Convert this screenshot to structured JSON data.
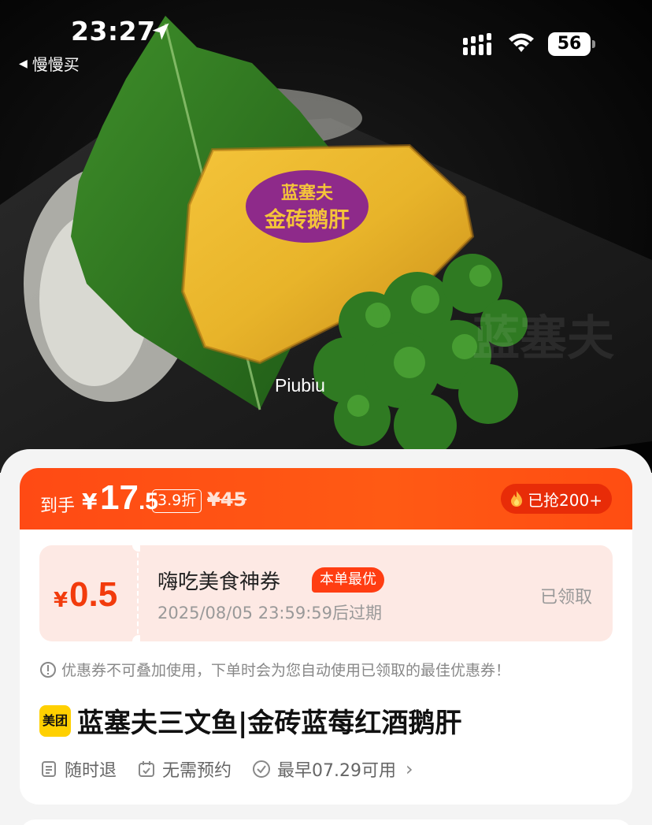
{
  "status_bar": {
    "time": "23:27",
    "back_app": "慢慢买",
    "battery": "56"
  },
  "hero": {
    "watermark": "Piubiu",
    "package_label_line1": "蓝塞夫",
    "package_label_line2": "金砖鹅肝",
    "bg_text": "蓝塞夫"
  },
  "price_bar": {
    "label": "到手",
    "currency": "¥",
    "price_int": "17",
    "price_dec": ".5",
    "discount": "3.9折",
    "original": "¥45",
    "sold": "已抢200+"
  },
  "coupon": {
    "currency": "¥",
    "value": "0.5",
    "title": "嗨吃美食神券",
    "tag": "本单最优",
    "expire": "2025/08/05 23:59:59后过期",
    "status": "已领取"
  },
  "notice": "优惠券不可叠加使用，下单时会为您自动使用已领取的最佳优惠券！",
  "product": {
    "brand_logo": "美团",
    "title": "蓝塞夫三文鱼|金砖蓝莓红酒鹅肝"
  },
  "features": [
    {
      "label": "随时退",
      "icon": "receipt-icon"
    },
    {
      "label": "无需预约",
      "icon": "calendar-check-icon"
    },
    {
      "label": "最早07.29可用",
      "icon": "check-circle-icon"
    }
  ],
  "colors": {
    "accent": "#ff4a14",
    "coupon_bg": "#fde9e4",
    "brand_yellow": "#ffd000"
  }
}
